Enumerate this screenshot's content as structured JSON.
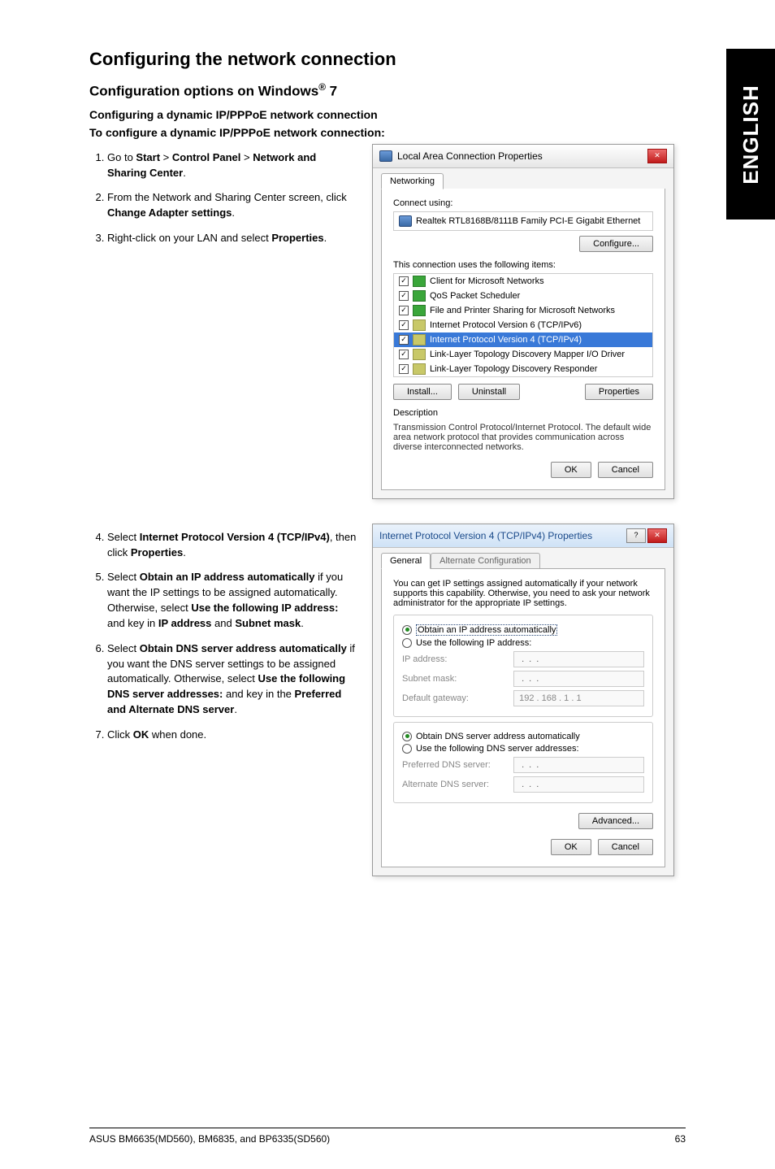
{
  "sidebar": {
    "lang": "ENGLISH"
  },
  "headings": {
    "section": "Configuring the network connection",
    "config_options": "Configuration options on Windows",
    "config_options_suffix": " 7",
    "cfg_dyn": "Configuring a dynamic IP/PPPoE network connection",
    "to_cfg": "To configure a dynamic IP/PPPoE network connection:"
  },
  "steps_a": {
    "s1_pre": "Go to ",
    "s1_start": "Start",
    "s1_gt1": " > ",
    "s1_cp": "Control Panel",
    "s1_gt2": " > ",
    "s1_nsc": "Network and Sharing Center",
    "s1_dot": ".",
    "s2_a": "From the Network and Sharing Center screen, click ",
    "s2_b": "Change Adapter settings",
    "s2_c": ".",
    "s3_a": "Right-click on your LAN and select ",
    "s3_b": "Properties",
    "s3_c": "."
  },
  "steps_b": {
    "s4_a": "Select ",
    "s4_b": "Internet Protocol Version 4 (TCP/IPv4)",
    "s4_c": ", then click ",
    "s4_d": "Properties",
    "s4_e": ".",
    "s5_a": "Select ",
    "s5_b": "Obtain an IP address automatically",
    "s5_c": " if you want the IP settings to be assigned automatically. Otherwise, select ",
    "s5_d": "Use the following IP address:",
    "s5_e": " and key in ",
    "s5_f": "IP address",
    "s5_g": " and ",
    "s5_h": "Subnet mask",
    "s5_i": ".",
    "s6_a": "Select ",
    "s6_b": "Obtain DNS server address automatically",
    "s6_c": " if you want the DNS server settings to be assigned automatically. Otherwise, select ",
    "s6_d": "Use the following DNS server addresses:",
    "s6_e": " and key in the ",
    "s6_f": "Preferred and Alternate DNS server",
    "s6_g": ".",
    "s7_a": "Click ",
    "s7_b": "OK",
    "s7_c": " when done."
  },
  "dialog1": {
    "title": "Local Area Connection Properties",
    "tab": "Networking",
    "connect_using": "Connect using:",
    "adapter": "Realtek RTL8168B/8111B Family PCI-E Gigabit Ethernet",
    "configure": "Configure...",
    "uses_items": "This connection uses the following items:",
    "items": [
      "Client for Microsoft Networks",
      "QoS Packet Scheduler",
      "File and Printer Sharing for Microsoft Networks",
      "Internet Protocol Version 6 (TCP/IPv6)",
      "Internet Protocol Version 4 (TCP/IPv4)",
      "Link-Layer Topology Discovery Mapper I/O Driver",
      "Link-Layer Topology Discovery Responder"
    ],
    "install": "Install...",
    "uninstall": "Uninstall",
    "properties": "Properties",
    "description_label": "Description",
    "description": "Transmission Control Protocol/Internet Protocol. The default wide area network protocol that provides communication across diverse interconnected networks.",
    "ok": "OK",
    "cancel": "Cancel"
  },
  "dialog2": {
    "title": "Internet Protocol Version 4 (TCP/IPv4) Properties",
    "tab_general": "General",
    "tab_alt": "Alternate Configuration",
    "intro": "You can get IP settings assigned automatically if your network supports this capability. Otherwise, you need to ask your network administrator for the appropriate IP settings.",
    "r_obtain_ip": "Obtain an IP address automatically",
    "r_use_ip": "Use the following IP address:",
    "ip_addr": "IP address:",
    "subnet": "Subnet mask:",
    "gateway": "Default gateway:",
    "gateway_val": "192 . 168 .   1  .   1",
    "r_obtain_dns": "Obtain DNS server address automatically",
    "r_use_dns": "Use the following DNS server addresses:",
    "pref_dns": "Preferred DNS server:",
    "alt_dns": "Alternate DNS server:",
    "advanced": "Advanced...",
    "ok": "OK",
    "cancel": "Cancel"
  },
  "footer": {
    "left": "ASUS BM6635(MD560), BM6835, and BP6335(SD560)",
    "right": "63"
  }
}
